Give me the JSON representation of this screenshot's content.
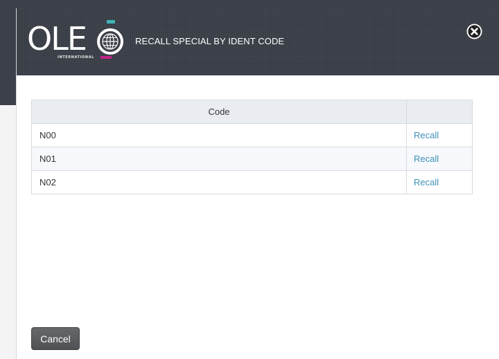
{
  "brand": {
    "logo_text": "OLE",
    "logo_subtext": "INTERNATIONAL"
  },
  "dialog": {
    "title": "RECALL SPECIAL BY IDENT CODE",
    "close_icon": "close-icon"
  },
  "table": {
    "columns": [
      "Code",
      ""
    ],
    "rows": [
      {
        "code": "N00",
        "action": "Recall"
      },
      {
        "code": "N01",
        "action": "Recall"
      },
      {
        "code": "N02",
        "action": "Recall"
      }
    ]
  },
  "footer": {
    "cancel_label": "Cancel"
  },
  "colors": {
    "header_bg": "#383c45",
    "link": "#3d8fb8",
    "logo_accent_teal": "#3fb5b5",
    "logo_accent_pink": "#c2228a"
  }
}
